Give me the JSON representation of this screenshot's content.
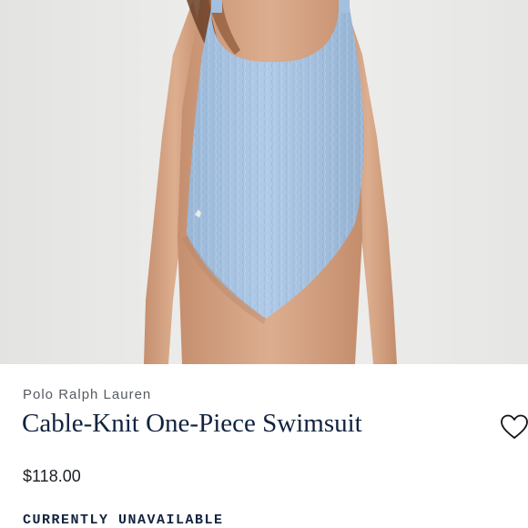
{
  "product": {
    "image_subject": "model-wearing-blue-swimsuit",
    "brand": "Polo Ralph Lauren",
    "title": "Cable-Knit One-Piece Swimsuit",
    "price": "$118.00",
    "availability": "CURRENTLY UNAVAILABLE",
    "wishlist_icon": "heart-outline-icon"
  },
  "colors": {
    "title": "#12233f",
    "brand": "#555a60",
    "swimsuit": "#a9c6e6",
    "background": "#ffffff"
  }
}
